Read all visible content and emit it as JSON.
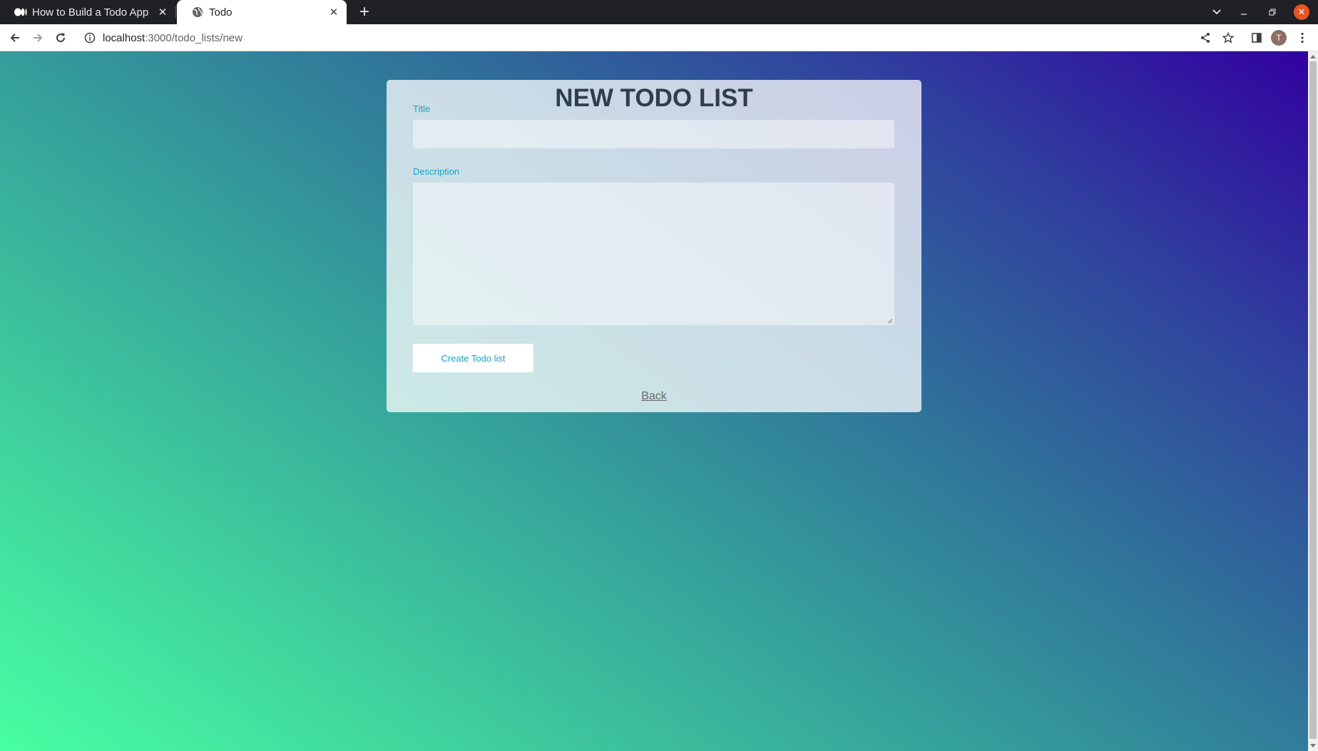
{
  "browser": {
    "tabs": [
      {
        "title": "How to Build a Todo App",
        "icon": "medium-icon",
        "active": false
      },
      {
        "title": "Todo",
        "icon": "globe-icon",
        "active": true
      }
    ],
    "url": {
      "host": "localhost",
      "path": ":3000/todo_lists/new"
    },
    "profile_initial": "T"
  },
  "page": {
    "heading": "NEW TODO LIST",
    "form": {
      "title_label": "Title",
      "title_value": "",
      "description_label": "Description",
      "description_value": "",
      "submit_label": "Create Todo list"
    },
    "back_link": "Back"
  },
  "colors": {
    "accent": "#17a2c8",
    "heading": "#2f3e4a",
    "gradient_start": "#48ffa3",
    "gradient_end": "#3100a0"
  }
}
